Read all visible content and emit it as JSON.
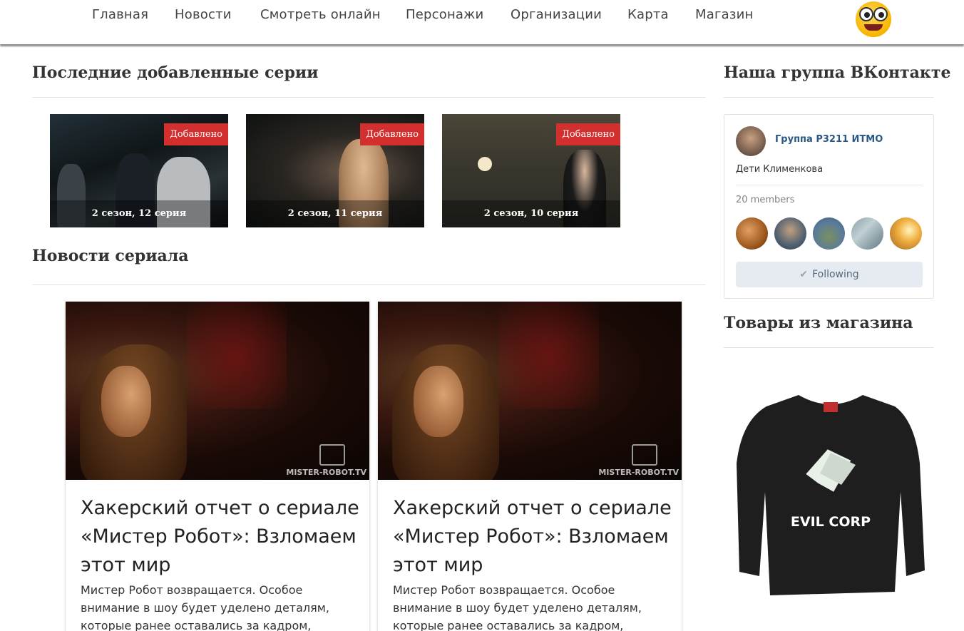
{
  "nav": {
    "items": [
      {
        "label": "Главная"
      },
      {
        "label": "Новости"
      },
      {
        "label": "Смотреть онлайн"
      },
      {
        "label": "Персонажи"
      },
      {
        "label": "Организации"
      },
      {
        "label": "Карта"
      },
      {
        "label": "Магазин"
      }
    ],
    "logo_icon": "crazy-eyes-emoji-icon"
  },
  "latest": {
    "title": "Последние добавленные серии",
    "episodes": [
      {
        "badge": "Добавлено",
        "caption": "2 сезон, 12 серия"
      },
      {
        "badge": "Добавлено",
        "caption": "2 сезон, 11 серия"
      },
      {
        "badge": "Добавлено",
        "caption": "2 сезон, 10 серия"
      }
    ]
  },
  "news": {
    "title": "Новости сериала",
    "cards": [
      {
        "title": "Хакерский отчет о сериале «Мистер Робот»: Взломаем этот мир",
        "text": "Мистер Робот возвращается. Особое внимание в шоу будет уделено деталям, которые ранее оставались за кадром,",
        "watermark": "MISTER-ROBOT.TV"
      },
      {
        "title": "Хакерский отчет о сериале «Мистер Робот»: Взломаем этот мир",
        "text": "Мистер Робот возвращается. Особое внимание в шоу будет уделено деталям, которые ранее оставались за кадром,",
        "watermark": "MISTER-ROBOT.TV"
      }
    ]
  },
  "vk": {
    "title": "Наша группа ВКонтакте",
    "group_name": "Группа P3211 ИТМО",
    "description": "Дети Клименкова",
    "members": "20 members",
    "follow_label": "Following",
    "check_icon": "✔"
  },
  "shop": {
    "title": "Товары из магазина",
    "product_text": "EVIL CORP"
  },
  "colors": {
    "badge": "#d32f2f",
    "vk_link": "#2a5885",
    "follow_bg": "#e5ebf1"
  }
}
